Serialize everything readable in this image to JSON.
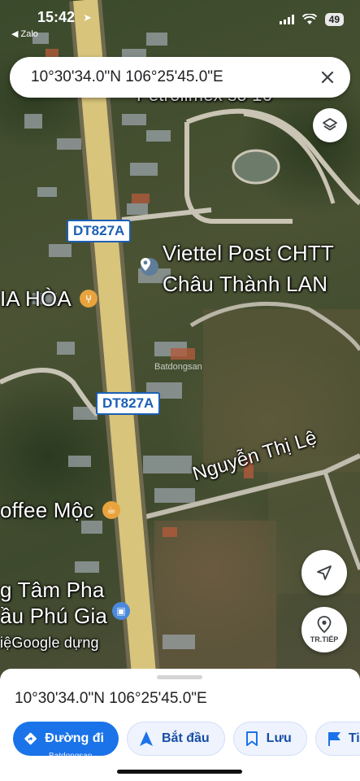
{
  "status_bar": {
    "time": "15:42",
    "back_app": "◀ Zalo",
    "battery": "49"
  },
  "search": {
    "coordinates": "10°30'34.0\"N 106°25'45.0\"E"
  },
  "map": {
    "labels": {
      "petrolimex": "Petrolimex số 16",
      "viettel_line1": "Viettel Post CHTT",
      "viettel_line2": "Châu Thành LAN",
      "gia_hoa": "IA HÒA",
      "coffee": "offee Mộc",
      "nguyen_thi_le": "Nguyễn Thị Lệ",
      "tam_pha": "g Tâm Pha",
      "phu_gia": "ầu Phú Gia",
      "google": "Google",
      "google_prefix": "iệ",
      "google_suffix": "dựng",
      "watermark_map": "Batdongsan"
    },
    "road_shields": {
      "top": "DT827A",
      "middle": "DT827A"
    },
    "layers_button_icon": "layers-icon",
    "locate_button_icon": "navigation-arrow-icon",
    "street_view_label": "TR.TIẾP"
  },
  "sheet": {
    "coordinates": "10°30'34.0\"N 106°25'45.0\"E",
    "actions": {
      "directions": "Đường đi",
      "start": "Bắt đầu",
      "save": "Lưu",
      "next": "Ti"
    },
    "watermark": "Batdongsan"
  },
  "colors": {
    "primary": "#1a73e8",
    "chip_bg": "#eef3fd",
    "chip_text": "#174ea6",
    "road": "#d8c47a"
  }
}
